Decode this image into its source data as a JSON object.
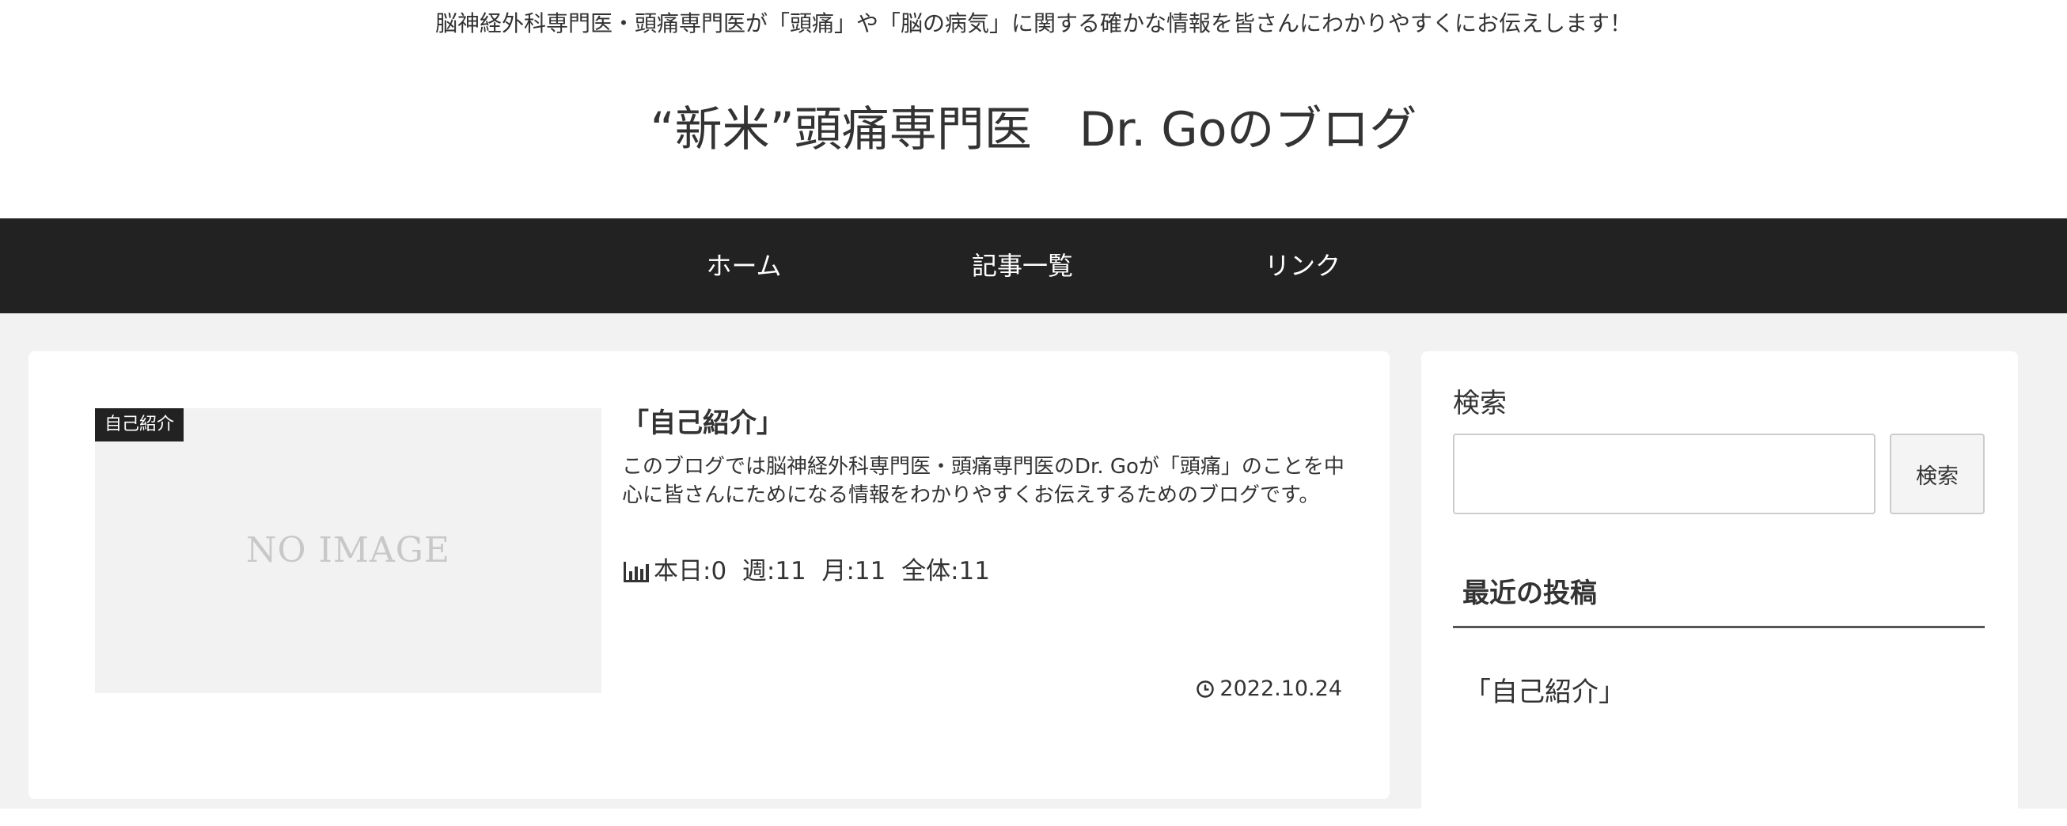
{
  "header": {
    "tagline": "脳神経外科専門医・頭痛専門医が「頭痛」や「脳の病気」に関する確かな情報を皆さんにわかりやすくにお伝えします！",
    "site_title": "“新米”頭痛専門医　Dr. Goのブログ"
  },
  "nav": {
    "items": [
      {
        "label": "ホーム"
      },
      {
        "label": "記事一覧"
      },
      {
        "label": "リンク"
      }
    ]
  },
  "post": {
    "category": "自己紹介",
    "thumbnail_text": "NO IMAGE",
    "title": "「自己紹介」",
    "excerpt": "このブログでは脳神経外科専門医・頭痛専門医のDr. Goが「頭痛」のことを中心に皆さんにためになる情報をわかりやすくお伝えするためのブログです。",
    "stats": "本日:0  週:11  月:11  全体:11",
    "date": "2022.10.24"
  },
  "sidebar": {
    "search_heading": "検索",
    "search_value": "",
    "search_button": "検索",
    "recent_heading": "最近の投稿",
    "recent_posts": [
      {
        "title": "「自己紹介」"
      }
    ]
  },
  "colors": {
    "nav_bg": "#222222",
    "page_bg": "#f2f2f2",
    "card_bg": "#ffffff",
    "badge_bg": "#222222",
    "text": "#333333"
  },
  "icons": {
    "stats": "bar-chart-icon",
    "date": "clock-icon"
  }
}
